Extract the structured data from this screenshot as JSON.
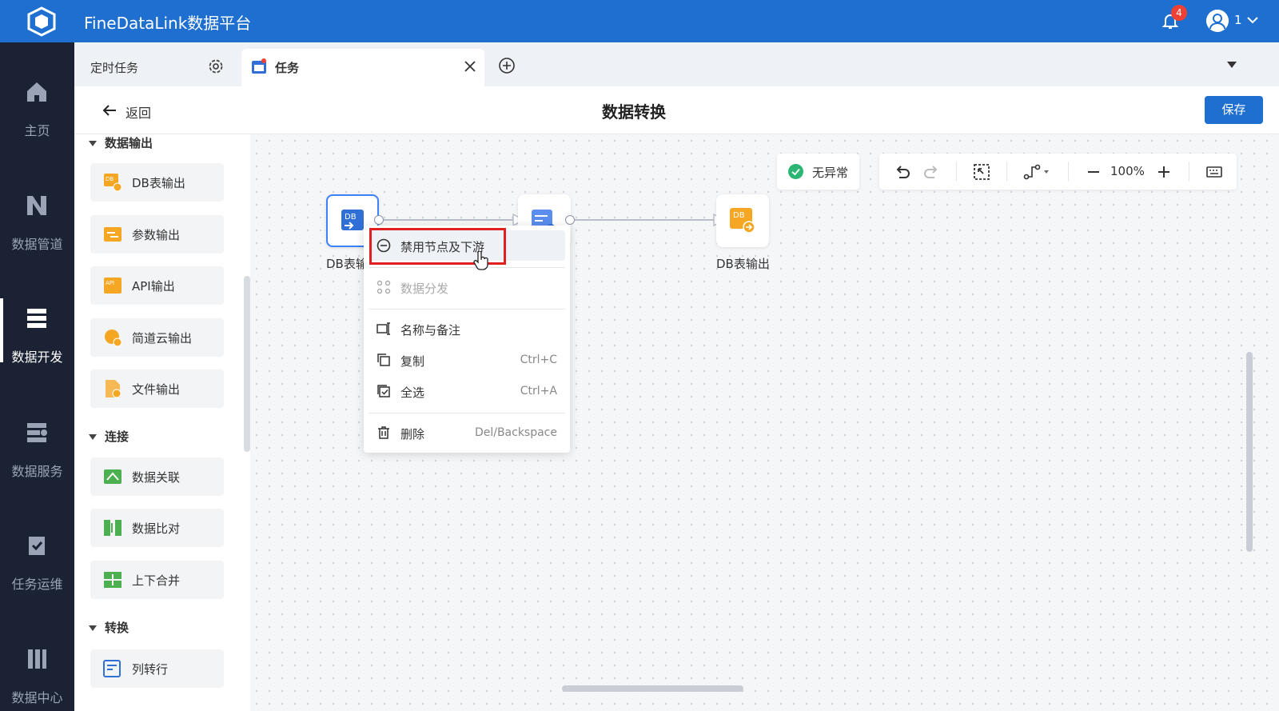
{
  "app": {
    "title": "FineDataLink数据平台"
  },
  "header": {
    "notification_count": "4",
    "user_name": "1"
  },
  "nav": {
    "items": [
      {
        "label": "主页",
        "icon": "home-icon"
      },
      {
        "label": "数据管道",
        "icon": "pipeline-icon"
      },
      {
        "label": "数据开发",
        "icon": "dev-icon",
        "active": true
      },
      {
        "label": "数据服务",
        "icon": "service-icon"
      },
      {
        "label": "任务运维",
        "icon": "ops-icon"
      },
      {
        "label": "数据中心",
        "icon": "center-icon"
      }
    ]
  },
  "tabs": {
    "scheduled": "定时任务",
    "task": "任务"
  },
  "page": {
    "back": "返回",
    "title": "数据转换",
    "save": "保存"
  },
  "panel": {
    "sections": [
      {
        "title": "数据输出",
        "items": [
          "DB表输出",
          "参数输出",
          "API输出",
          "简道云输出",
          "文件输出"
        ]
      },
      {
        "title": "连接",
        "items": [
          "数据关联",
          "数据比对",
          "上下合并"
        ]
      },
      {
        "title": "转换",
        "items": [
          "列转行"
        ]
      }
    ]
  },
  "canvas": {
    "status": "无异常",
    "zoom": "100%",
    "nodes": [
      {
        "label": "DB表输",
        "icon_text": "DB"
      },
      {
        "label": "",
        "icon_text": ""
      },
      {
        "label": "DB表输出",
        "icon_text": "DB"
      }
    ]
  },
  "context_menu": {
    "items": [
      {
        "label": "禁用节点及下游",
        "shortcut": "",
        "icon": "disable-icon"
      },
      {
        "label": "数据分发",
        "shortcut": "",
        "icon": "distribute-icon",
        "disabled": true
      },
      {
        "label": "名称与备注",
        "shortcut": "",
        "icon": "rename-icon"
      },
      {
        "label": "复制",
        "shortcut": "Ctrl+C",
        "icon": "copy-icon"
      },
      {
        "label": "全选",
        "shortcut": "Ctrl+A",
        "icon": "select-all-icon"
      },
      {
        "label": "删除",
        "shortcut": "Del/Backspace",
        "icon": "delete-icon"
      }
    ]
  },
  "colors": {
    "primary": "#1e6fd0",
    "nav_bg": "#1a2233",
    "highlight": "#e02020",
    "ok": "#2bb673",
    "node_orange": "#f5a623"
  }
}
